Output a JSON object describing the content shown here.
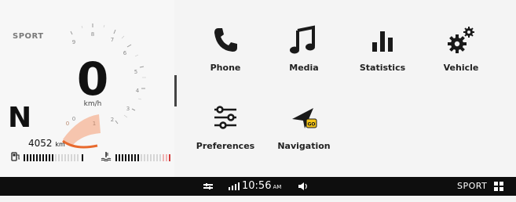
{
  "cluster": {
    "mode_label": "SPORT",
    "speed": "0",
    "speed_unit": "km/h",
    "gear": "N",
    "odometer_value": "4052",
    "odometer_unit": "km",
    "tach_labels": [
      "0",
      "1",
      "2",
      "3",
      "4",
      "5",
      "6",
      "7",
      "8",
      "9"
    ],
    "fuel_icon": "fuel-pump-icon",
    "temp_icon": "coolant-temperature-icon",
    "accent_color": "#e86a2e",
    "redline_color": "#d43c3c"
  },
  "apps": [
    {
      "label": "Phone",
      "icon": "phone-icon"
    },
    {
      "label": "Media",
      "icon": "music-note-icon"
    },
    {
      "label": "Statistics",
      "icon": "bar-chart-icon"
    },
    {
      "label": "Vehicle",
      "icon": "gears-icon"
    },
    {
      "label": "Preferences",
      "icon": "sliders-icon"
    },
    {
      "label": "Navigation",
      "icon": "navigation-arrow-icon"
    }
  ],
  "statusbar": {
    "connection_icon": "link-icon",
    "signal_icon": "signal-bars-icon",
    "time": "10:56",
    "ampm": "AM",
    "volume_icon": "volume-icon",
    "mode": "SPORT",
    "grid_icon": "app-grid-icon",
    "background_color": "#0e0e0e"
  }
}
